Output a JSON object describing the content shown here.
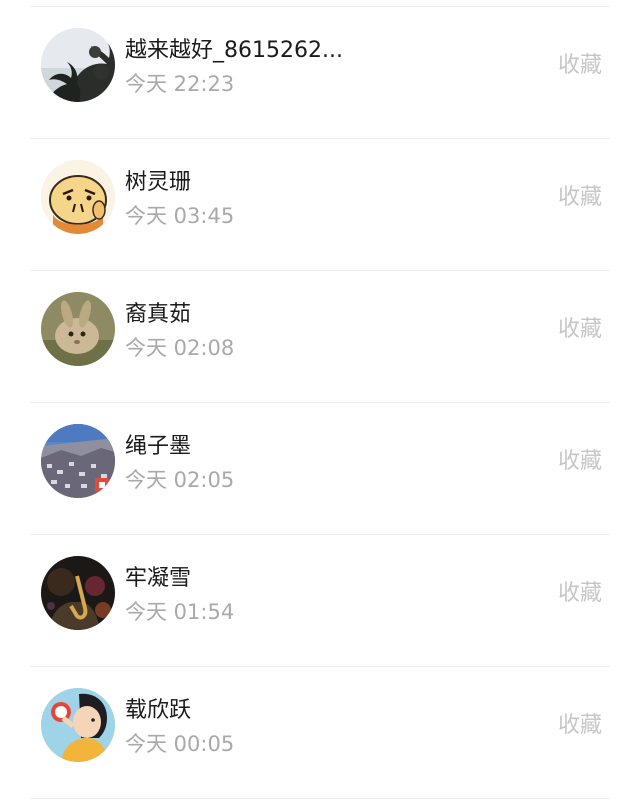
{
  "contacts": [
    {
      "name": "越来越好_8615262...",
      "time": "今天 22:23",
      "action": "收藏",
      "avatar_icon": "avatar-plant-silhouette"
    },
    {
      "name": "树灵珊",
      "time": "今天 03:45",
      "action": "收藏",
      "avatar_icon": "avatar-cartoon-face"
    },
    {
      "name": "裔真茹",
      "time": "今天 02:08",
      "action": "收藏",
      "avatar_icon": "avatar-rabbit"
    },
    {
      "name": "绳子墨",
      "time": "今天 02:05",
      "action": "收藏",
      "avatar_icon": "avatar-town-landscape"
    },
    {
      "name": "牢凝雪",
      "time": "今天 01:54",
      "action": "收藏",
      "avatar_icon": "avatar-musician-dark"
    },
    {
      "name": "载欣跃",
      "time": "今天 00:05",
      "action": "收藏",
      "avatar_icon": "avatar-girl-illustration"
    }
  ],
  "colors": {
    "name_text": "#1a1a1a",
    "time_text": "#a9a9a9",
    "action_text": "#c6c6c6",
    "divider": "#ececec"
  }
}
